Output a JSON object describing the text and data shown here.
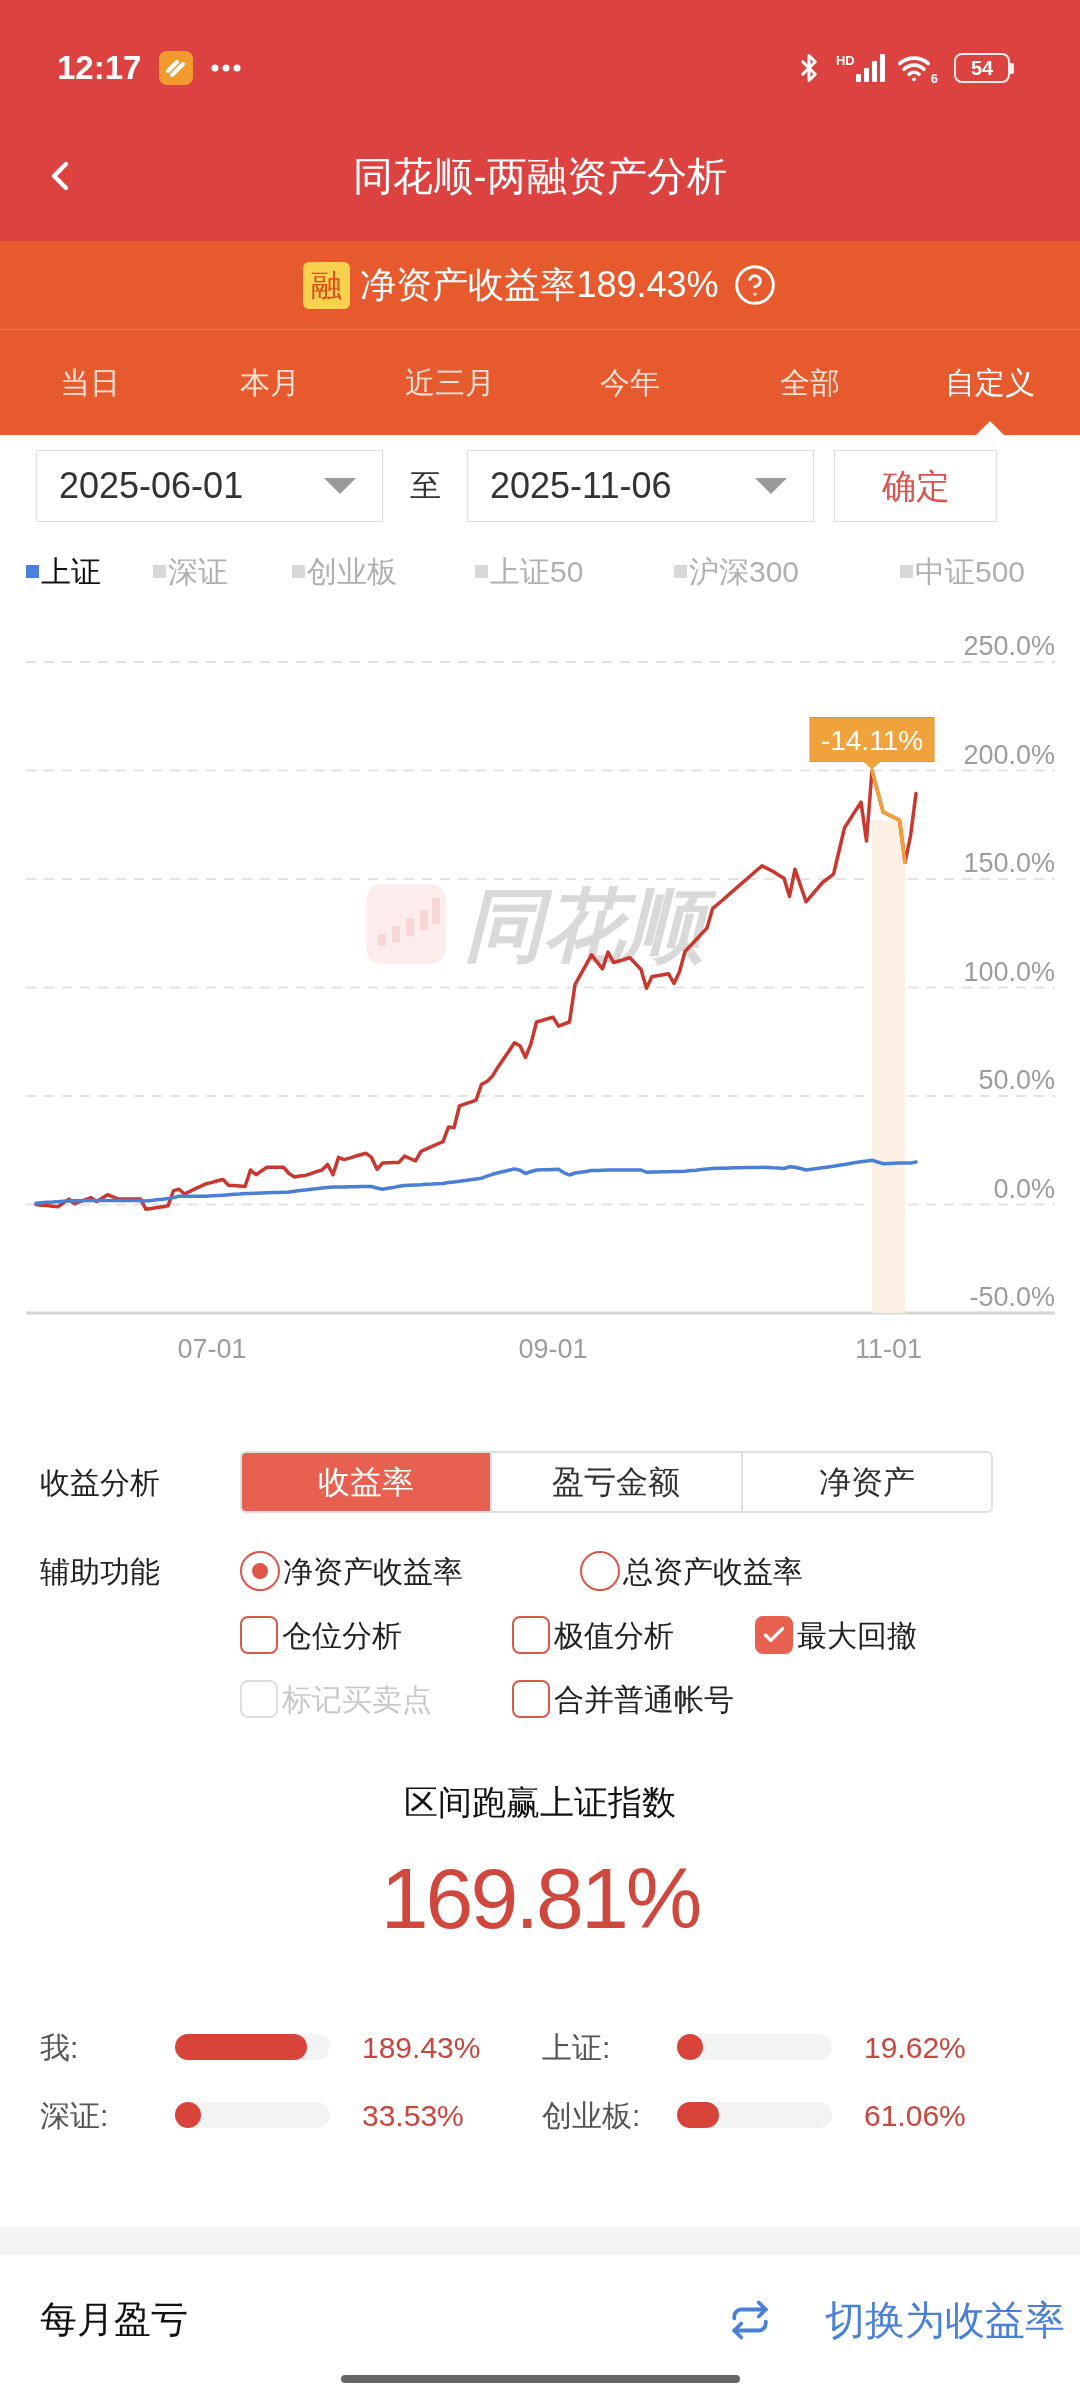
{
  "status_bar": {
    "time": "12:17",
    "network_label": "HD",
    "wifi_label": "6",
    "battery": "54"
  },
  "header": {
    "title": "同花顺-两融资产分析"
  },
  "banner": {
    "badge": "融",
    "text": "净资产收益率189.43%"
  },
  "period_tabs": [
    {
      "label": "当日",
      "selected": false
    },
    {
      "label": "本月",
      "selected": false
    },
    {
      "label": "近三月",
      "selected": false
    },
    {
      "label": "今年",
      "selected": false
    },
    {
      "label": "全部",
      "selected": false
    },
    {
      "label": "自定义",
      "selected": true
    }
  ],
  "date_range": {
    "start": "2025-06-01",
    "separator": "至",
    "end": "2025-11-06",
    "confirm": "确定"
  },
  "legend": [
    {
      "label": "上证",
      "selected": true
    },
    {
      "label": "深证",
      "selected": false
    },
    {
      "label": "创业板",
      "selected": false
    },
    {
      "label": "上证50",
      "selected": false
    },
    {
      "label": "沪深300",
      "selected": false
    },
    {
      "label": "中证500",
      "selected": false
    }
  ],
  "chart": {
    "watermark": "同花顺",
    "chart_data": {
      "type": "line",
      "grid": true,
      "categories": [
        null,
        null,
        null,
        null,
        null,
        null,
        null,
        null,
        null,
        null,
        null,
        null,
        null,
        null,
        null,
        null,
        null,
        null,
        null,
        null,
        null,
        null,
        null,
        null,
        null,
        null,
        null,
        null,
        null,
        null,
        null,
        null,
        "07-01",
        null,
        null,
        null,
        null,
        null,
        null,
        null,
        null,
        null,
        null,
        null,
        null,
        null,
        null,
        null,
        null,
        null,
        null,
        null,
        null,
        null,
        null,
        null,
        null,
        null,
        null,
        null,
        null,
        null,
        null,
        null,
        null,
        null,
        null,
        null,
        null,
        null,
        null,
        null,
        null,
        null,
        null,
        null,
        null,
        null,
        null,
        null,
        null,
        null,
        null,
        null,
        null,
        null,
        null,
        null,
        null,
        null,
        null,
        null,
        null,
        null,
        "09-01",
        null,
        null,
        null,
        null,
        null,
        null,
        null,
        null,
        null,
        null,
        null,
        null,
        null,
        null,
        null,
        null,
        null,
        null,
        null,
        null,
        null,
        null,
        null,
        null,
        null,
        null,
        null,
        null,
        null,
        null,
        null,
        null,
        null,
        null,
        null,
        null,
        null,
        null,
        null,
        null,
        null,
        null,
        null,
        null,
        null,
        null,
        null,
        null,
        null,
        null,
        null,
        null,
        null,
        null,
        null,
        null,
        null,
        null,
        null,
        null,
        "11-01",
        null,
        null,
        null,
        null,
        null
      ],
      "series": [
        {
          "color": "#c9372e",
          "values": [
            0,
            -0.3,
            -0.5,
            -0.8,
            -1,
            0.8,
            2.5,
            0.3,
            1.3,
            2.2,
            3.2,
            1.3,
            2.9,
            4.5,
            3.5,
            2.5,
            2.5,
            2.5,
            2.5,
            2.5,
            -2.2,
            -1.8,
            -1.4,
            -1.0,
            -0.6,
            6.4,
            7,
            4.8,
            6.1,
            7.3,
            8.5,
            9.6,
            10.2,
            10.9,
            11.5,
            8.9,
            8.7,
            8.5,
            8.3,
            15.9,
            13.7,
            15.5,
            17.2,
            17.2,
            17.2,
            17.2,
            14.3,
            12.7,
            13.1,
            13.4,
            14.2,
            15.1,
            15.9,
            18.5,
            13.7,
            21.7,
            20.7,
            21.4,
            22.2,
            22.9,
            23.6,
            21.7,
            16.2,
            19.1,
            19.2,
            19.3,
            19.4,
            22.3,
            21.2,
            20.1,
            24.5,
            25.6,
            26.8,
            27.9,
            29,
            35.7,
            35.4,
            45.5,
            46.4,
            47.2,
            48.1,
            55.4,
            56.7,
            59.2,
            63.4,
            67.1,
            70.8,
            74.5,
            73.2,
            67.8,
            74.2,
            84.1,
            84.8,
            85.6,
            86.3,
            82.2,
            83.2,
            84.1,
            101.3,
            105.9,
            110.4,
            115,
            111.8,
            108.6,
            116.3,
            111.5,
            112.2,
            113.0,
            113.7,
            111.0,
            108.3,
            99.7,
            105,
            105.4,
            105.9,
            106.3,
            101.9,
            107.3,
            116.6,
            119.3,
            122.0,
            124.7,
            127.4,
            136.3,
            138.5,
            140.7,
            142.9,
            145.1,
            147.3,
            149.5,
            151.7,
            153.9,
            156.1,
            154.8,
            153.5,
            151.9,
            150.3,
            142,
            154.5,
            147.0,
            139.5,
            142.5,
            145.4,
            148.4,
            150.3,
            152.2,
            162.9,
            173.6,
            177.5,
            181.5,
            185.4,
            167.5,
            200,
            190.5,
            180.9,
            179.6,
            178.4,
            177.1,
            157.7,
            169.8,
            189.4
          ]
        },
        {
          "color": "#4a7fd6",
          "values": [
            0.6,
            0.8,
            1.0,
            1.1,
            1.3,
            1.5,
            1.6,
            1.7,
            1.7,
            1.8,
            1.8,
            1.8,
            1.9,
            1.9,
            1.9,
            1.9,
            1.9,
            1.8,
            1.8,
            1.7,
            1.6,
            1.9,
            2.2,
            2.4,
            2.7,
            3.2,
            3.8,
            3.8,
            3.8,
            3.8,
            3.8,
            3.8,
            4.0,
            4.1,
            4.3,
            4.5,
            4.7,
            4.8,
            5.0,
            5.1,
            5.2,
            5.3,
            5.4,
            5.5,
            5.5,
            5.6,
            5.7,
            6.1,
            6.4,
            6.7,
            7.0,
            7.3,
            7.6,
            7.8,
            8.0,
            8.1,
            8.1,
            8.2,
            8.2,
            8.3,
            8.3,
            8.3,
            7.6,
            7.0,
            7.5,
            7.9,
            8.4,
            8.8,
            8.9,
            9.0,
            9.1,
            9.3,
            9.4,
            9.6,
            9.7,
            10.1,
            10.4,
            10.7,
            11.0,
            11.4,
            11.7,
            12.1,
            13.1,
            13.9,
            14.6,
            15.2,
            15.8,
            16.4,
            15.8,
            14.3,
            15.2,
            15.9,
            16.0,
            16.0,
            16.1,
            16.2,
            14.6,
            13.6,
            14.5,
            14.9,
            15.2,
            15.6,
            15.7,
            15.8,
            15.9,
            15.9,
            15.9,
            15.9,
            15.9,
            15.9,
            15.9,
            14.9,
            15.0,
            15.0,
            15.1,
            15.1,
            15.2,
            15.2,
            15.3,
            15.6,
            15.8,
            16.1,
            16.3,
            16.6,
            16.7,
            16.7,
            16.8,
            16.9,
            16.9,
            17.0,
            17.1,
            17.1,
            17.2,
            17.1,
            16.9,
            16.8,
            16.6,
            17.4,
            17.2,
            16.6,
            15.9,
            16.2,
            16.6,
            16.9,
            17.3,
            17.6,
            18.1,
            18.5,
            18.9,
            19.3,
            19.7,
            20.0,
            20.4,
            19.6,
            18.8,
            18.9,
            19.0,
            19.1,
            19.1,
            19.1,
            19.6
          ]
        }
      ],
      "ylim": [
        -50,
        250
      ],
      "yticks": [
        {
          "value": -50,
          "label": "-50.0%"
        },
        {
          "value": 0,
          "label": "0.0%"
        },
        {
          "value": 50,
          "label": "50.0%"
        },
        {
          "value": 100,
          "label": "100.0%"
        },
        {
          "value": 150,
          "label": "150.0%"
        },
        {
          "value": 200,
          "label": "200.0%"
        },
        {
          "value": 250,
          "label": "250.0%"
        }
      ],
      "annotations": [
        {
          "text": "-14.11%"
        }
      ]
    }
  },
  "analysis": {
    "label": "收益分析",
    "segments": [
      {
        "label": "收益率",
        "selected": true
      },
      {
        "label": "盈亏金额",
        "selected": false
      },
      {
        "label": "净资产",
        "selected": false
      }
    ]
  },
  "options": {
    "label": "辅助功能",
    "rows": [
      [
        {
          "kind": "radio",
          "label": "净资产收益率",
          "selected": true,
          "disabled": false
        },
        {
          "kind": "radio",
          "label": "总资产收益率",
          "selected": false,
          "disabled": false
        }
      ],
      [
        {
          "kind": "checkbox",
          "label": "仓位分析",
          "checked": false,
          "disabled": false
        },
        {
          "kind": "checkbox",
          "label": "极值分析",
          "checked": false,
          "disabled": false
        },
        {
          "kind": "checkbox",
          "label": "最大回撤",
          "checked": true,
          "disabled": false
        }
      ],
      [
        {
          "kind": "checkbox",
          "label": "标记买卖点",
          "checked": false,
          "disabled": true
        },
        {
          "kind": "checkbox",
          "label": "合并普通帐号",
          "checked": false,
          "disabled": false
        }
      ]
    ]
  },
  "outperform": {
    "title": "区间跑赢上证指数",
    "value": "169.81%"
  },
  "comparison": [
    {
      "label": "我:",
      "level": 0.85,
      "value": "189.43%"
    },
    {
      "label": "上证:",
      "level": 0.09,
      "value": "19.62%"
    },
    {
      "label": "深证:",
      "level": 0.15,
      "value": "33.53%"
    },
    {
      "label": "创业板:",
      "level": 0.27,
      "value": "61.06%"
    }
  ],
  "monthly": {
    "title": "每月盈亏",
    "switch_label": "切换为收益率"
  }
}
